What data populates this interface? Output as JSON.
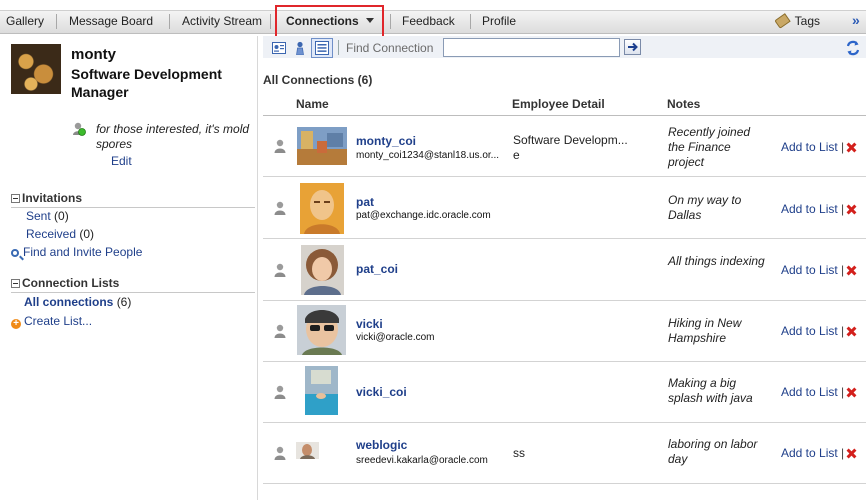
{
  "nav": {
    "tabs": [
      {
        "label": "Gallery"
      },
      {
        "label": "Message Board"
      },
      {
        "label": "Activity Stream"
      },
      {
        "label": "Connections"
      },
      {
        "label": "Feedback"
      },
      {
        "label": "Profile"
      }
    ],
    "active_tab": "Connections",
    "tags_label": "Tags",
    "more_label": "»"
  },
  "profile": {
    "name": "monty",
    "title": "Software Development Manager",
    "status": "for those interested, it's mold spores",
    "edit_label": "Edit"
  },
  "invitations": {
    "heading": "Invitations",
    "sent_label": "Sent",
    "sent_count": "(0)",
    "received_label": "Received",
    "received_count": "(0)",
    "find_label": "Find and Invite People"
  },
  "connection_lists": {
    "heading": "Connection Lists",
    "all_label": "All connections",
    "all_count": "(6)",
    "create_label": "Create List..."
  },
  "toolbar": {
    "find_label": "Find Connection",
    "find_value": ""
  },
  "list": {
    "title": "All Connections (6)",
    "columns": {
      "name": "Name",
      "detail": "Employee Detail",
      "notes": "Notes"
    },
    "add_label": "Add to List",
    "pipe": "|",
    "rows": [
      {
        "username": "monty_coi",
        "email": "monty_coi1234@stanl18.us.or...",
        "detail_line1": "Software Developm...",
        "detail_line2": "e",
        "note": "Recently joined the Finance project"
      },
      {
        "username": "pat",
        "email": "pat@exchange.idc.oracle.com",
        "detail_line1": "",
        "detail_line2": "",
        "note": "On my way to Dallas"
      },
      {
        "username": "pat_coi",
        "email": "",
        "detail_line1": "",
        "detail_line2": "",
        "note": "All things indexing"
      },
      {
        "username": "vicki",
        "email": "vicki@oracle.com",
        "detail_line1": "",
        "detail_line2": "",
        "note": "Hiking in New Hampshire"
      },
      {
        "username": "vicki_coi",
        "email": "",
        "detail_line1": "",
        "detail_line2": "",
        "note": "Making a big splash with java"
      },
      {
        "username": "weblogic",
        "email": "sreedevi.kakarla@oracle.com",
        "detail_line1": "ss",
        "detail_line2": "",
        "note": "laboring on labor day"
      }
    ]
  },
  "colors": {
    "link": "#1f3f8a",
    "highlight_box": "#e0262b",
    "delete": "#d3201c"
  }
}
